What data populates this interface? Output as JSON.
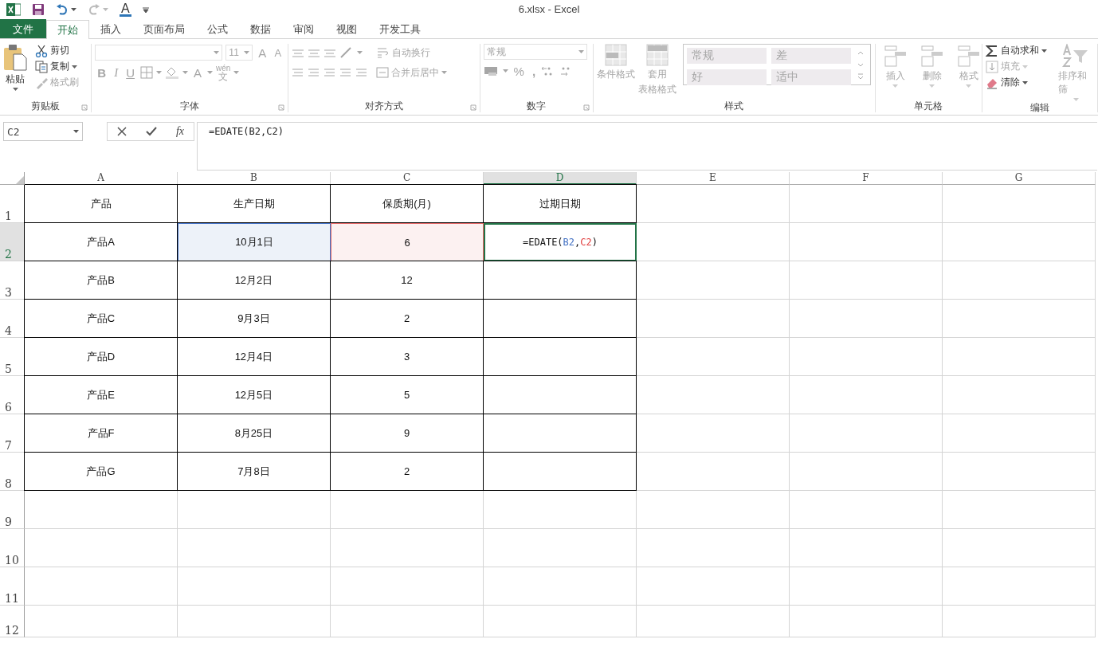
{
  "window": {
    "title": "6.xlsx - Excel",
    "font_color_glyph": "A"
  },
  "ribbon_tabs": [
    {
      "label": "文件",
      "kind": "file",
      "selected": false
    },
    {
      "label": "开始",
      "kind": "tab",
      "selected": true
    },
    {
      "label": "插入",
      "kind": "tab",
      "selected": false
    },
    {
      "label": "页面布局",
      "kind": "tab",
      "selected": false
    },
    {
      "label": "公式",
      "kind": "tab",
      "selected": false
    },
    {
      "label": "数据",
      "kind": "tab",
      "selected": false
    },
    {
      "label": "审阅",
      "kind": "tab",
      "selected": false
    },
    {
      "label": "视图",
      "kind": "tab",
      "selected": false
    },
    {
      "label": "开发工具",
      "kind": "tab",
      "selected": false
    }
  ],
  "ribbon_groups": [
    {
      "kind": "clipboard",
      "label": "剪贴板",
      "commands": [
        {
          "label": "粘贴",
          "disabled": false
        },
        {
          "label": "剪切",
          "disabled": false
        },
        {
          "label": "复制",
          "disabled": false
        },
        {
          "label": "格式刷",
          "disabled": true
        }
      ]
    },
    {
      "kind": "font",
      "label": "字体",
      "disabled": true,
      "font_size": "11",
      "grow_glyph": "A",
      "shrink_glyph": "A",
      "style_glyphs": [
        "B",
        "I",
        "U"
      ],
      "color_glyph": "A",
      "phonetic_glyph": "wén",
      "phonetic_char": "文"
    },
    {
      "kind": "alignment",
      "label": "对齐方式",
      "disabled": true,
      "commands": [
        "自动换行",
        "合并后居中"
      ]
    },
    {
      "kind": "number",
      "label": "数字",
      "disabled": true,
      "format": "常规",
      "percent_glyph": "%",
      "comma_glyph": ","
    },
    {
      "kind": "styles",
      "label": "样式",
      "disabled": true,
      "commands": [
        {
          "lines": [
            "条件格式"
          ]
        },
        {
          "lines": [
            "套用",
            "表格格式"
          ]
        }
      ],
      "gallery": [
        "常规",
        "差",
        "好",
        "适中"
      ]
    },
    {
      "kind": "cells",
      "label": "单元格",
      "disabled": true,
      "commands": [
        "插入",
        "删除",
        "格式"
      ]
    },
    {
      "kind": "editing",
      "label": "编辑",
      "commands": [
        {
          "label": "自动求和",
          "disabled": false
        },
        {
          "label": "填充",
          "disabled": true
        },
        {
          "label": "清除",
          "disabled": false
        },
        {
          "label": "排序和筛",
          "disabled": true
        }
      ]
    }
  ],
  "formula_bar": {
    "name_box": "C2",
    "function_glyph": "fx",
    "formula": "=EDATE(B2,C2)"
  },
  "sheet": {
    "columns": [
      {
        "label": "A",
        "selected": false
      },
      {
        "label": "B",
        "selected": false
      },
      {
        "label": "C",
        "selected": false
      },
      {
        "label": "D",
        "selected": true
      },
      {
        "label": "E",
        "selected": false
      },
      {
        "label": "F",
        "selected": false
      },
      {
        "label": "G",
        "selected": false
      }
    ],
    "rows": [
      {
        "header": "1",
        "selected": false,
        "cells": [
          {
            "text": "产品",
            "bordered": true
          },
          {
            "text": "生产日期",
            "bordered": true
          },
          {
            "text": "保质期(月)",
            "bordered": true
          },
          {
            "text": "过期日期",
            "bordered": true
          }
        ]
      },
      {
        "header": "2",
        "selected": true,
        "cells": [
          {
            "text": "产品A",
            "bordered": true
          },
          {
            "text": "10月1日",
            "bordered": true,
            "color": "#4472c4"
          },
          {
            "text": "6",
            "bordered": true,
            "color": "#e06666"
          },
          {
            "parts": [
              {
                "text": "=EDATE("
              },
              {
                "text": "B2",
                "color": "#4472c4"
              },
              {
                "text": ","
              },
              {
                "text": "C2",
                "color": "#e03c3c"
              },
              {
                "text": ")"
              }
            ],
            "bordered": true,
            "active": true
          }
        ]
      },
      {
        "header": "3",
        "selected": false,
        "cells": [
          {
            "text": "产品B",
            "bordered": true
          },
          {
            "text": "12月2日",
            "bordered": true
          },
          {
            "text": "12",
            "bordered": true
          },
          {
            "bordered": true
          }
        ]
      },
      {
        "header": "4",
        "selected": false,
        "cells": [
          {
            "text": "产品C",
            "bordered": true
          },
          {
            "text": "9月3日",
            "bordered": true
          },
          {
            "text": "2",
            "bordered": true
          },
          {
            "bordered": true
          }
        ]
      },
      {
        "header": "5",
        "selected": false,
        "cells": [
          {
            "text": "产品D",
            "bordered": true
          },
          {
            "text": "12月4日",
            "bordered": true
          },
          {
            "text": "3",
            "bordered": true
          },
          {
            "bordered": true
          }
        ]
      },
      {
        "header": "6",
        "selected": false,
        "cells": [
          {
            "text": "产品E",
            "bordered": true
          },
          {
            "text": "12月5日",
            "bordered": true
          },
          {
            "text": "5",
            "bordered": true
          },
          {
            "bordered": true
          }
        ]
      },
      {
        "header": "7",
        "selected": false,
        "cells": [
          {
            "text": "产品F",
            "bordered": true
          },
          {
            "text": "8月25日",
            "bordered": true
          },
          {
            "text": "9",
            "bordered": true
          },
          {
            "bordered": true
          }
        ]
      },
      {
        "header": "8",
        "selected": false,
        "cells": [
          {
            "text": "产品G",
            "bordered": true
          },
          {
            "text": "7月8日",
            "bordered": true
          },
          {
            "text": "2",
            "bordered": true
          },
          {
            "bordered": true
          }
        ]
      },
      {
        "header": "9",
        "selected": false
      },
      {
        "header": "10",
        "selected": false
      },
      {
        "header": "11",
        "selected": false
      },
      {
        "header": "12",
        "selected": false
      }
    ]
  }
}
